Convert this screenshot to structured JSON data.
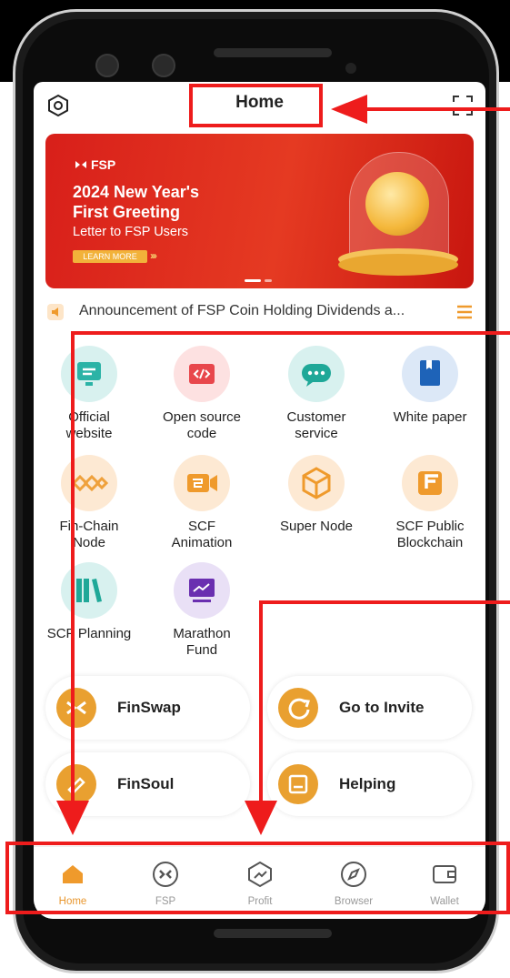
{
  "header": {
    "title": "Home"
  },
  "banner": {
    "brand": "FSP",
    "title_line1": "2024 New Year's",
    "title_line2": "First Greeting",
    "subtitle": "Letter to FSP Users",
    "button": "LEARN MORE"
  },
  "announcement": {
    "text": "Announcement of FSP Coin Holding Dividends a..."
  },
  "grid": [
    {
      "line1": "Official",
      "line2": "website",
      "icon": "monitor-icon"
    },
    {
      "line1": "Open source",
      "line2": "code",
      "icon": "code-icon"
    },
    {
      "line1": "Customer",
      "line2": "service",
      "icon": "chat-icon"
    },
    {
      "line1": "White paper",
      "line2": "",
      "icon": "book-icon"
    },
    {
      "line1": "Fin-Chain",
      "line2": "Node",
      "icon": "chain-node-icon"
    },
    {
      "line1": "SCF",
      "line2": "Animation",
      "icon": "video-icon"
    },
    {
      "line1": "Super Node",
      "line2": "",
      "icon": "cube-icon"
    },
    {
      "line1": "SCF Public",
      "line2": "Blockchain",
      "icon": "blockchain-icon"
    },
    {
      "line1": "SCF Planning",
      "line2": "",
      "icon": "books-icon"
    },
    {
      "line1": "Marathon",
      "line2": "Fund",
      "icon": "chart-screen-icon"
    }
  ],
  "cards": [
    {
      "label": "FinSwap",
      "icon": "swap-icon"
    },
    {
      "label": "Go to Invite",
      "icon": "invite-icon"
    },
    {
      "label": "FinSoul",
      "icon": "soul-icon"
    },
    {
      "label": "Helping",
      "icon": "helping-icon"
    }
  ],
  "tabs": [
    {
      "label": "Home",
      "icon": "home-icon",
      "active": true
    },
    {
      "label": "FSP",
      "icon": "fsp-icon"
    },
    {
      "label": "Profit",
      "icon": "profit-icon"
    },
    {
      "label": "Browser",
      "icon": "compass-icon"
    },
    {
      "label": "Wallet",
      "icon": "wallet-icon"
    }
  ],
  "colors": {
    "accent": "#e8962d",
    "annotation": "#ee1c1c",
    "banner": "#d81f1a"
  }
}
